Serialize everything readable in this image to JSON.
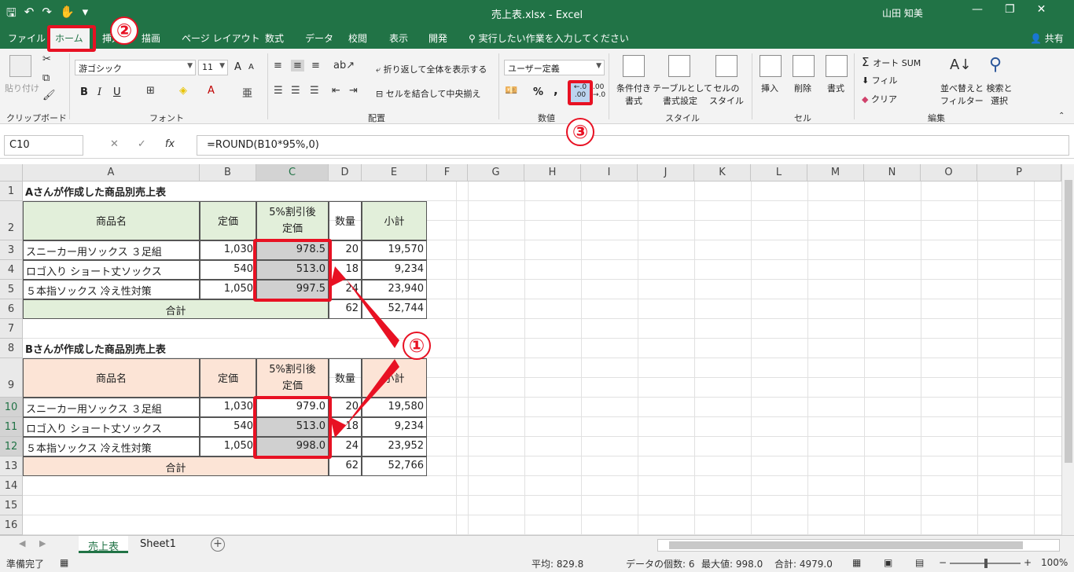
{
  "window": {
    "title": "売上表.xlsx - Excel",
    "user": "山田 知美",
    "minimize": "—",
    "restore": "❐",
    "close": "✕"
  },
  "qat": {
    "save": "🖫",
    "undo": "↶",
    "redo": "↷",
    "touch": "✋",
    "more": "▾"
  },
  "tabs": [
    "ファイル",
    "ホーム",
    "挿入",
    "描画",
    "ページ レイアウト",
    "数式",
    "データ",
    "校閲",
    "表示",
    "開発"
  ],
  "tellme": "実行したい作業を入力してください",
  "share": "共有",
  "ribbon": {
    "clipboard": {
      "label": "クリップボード",
      "paste": "貼り付け"
    },
    "font": {
      "label": "フォント",
      "name": "游ゴシック",
      "size": "11",
      "grow": "A",
      "shrink": "A",
      "bold": "B",
      "italic": "I",
      "underline": "U"
    },
    "alignment": {
      "label": "配置",
      "wrap": "折り返して全体を表示する",
      "merge": "セルを結合して中央揃え"
    },
    "number": {
      "label": "数値",
      "format": "ユーザー定義",
      "percent": "%",
      "comma": ",",
      "inc_decimal": "←.0 .00",
      "dec_decimal": ".00 →.0"
    },
    "styles": {
      "label": "スタイル",
      "conditional": [
        "条件付き",
        "書式"
      ],
      "table": [
        "テーブルとして",
        "書式設定"
      ],
      "cell": [
        "セルの",
        "スタイル"
      ]
    },
    "cells": {
      "label": "セル",
      "insert": "挿入",
      "delete": "削除",
      "format": "書式"
    },
    "editing": {
      "label": "編集",
      "autosum": "オート SUM",
      "fill": "フィル",
      "clear": "クリア",
      "sort": [
        "並べ替えと",
        "フィルター"
      ],
      "find": [
        "検索と",
        "選択"
      ]
    }
  },
  "formula": {
    "namebox": "C10",
    "cancel": "✕",
    "enter": "✓",
    "fx": "fx",
    "value": "=ROUND(B10*95%,0)"
  },
  "columns": [
    "A",
    "B",
    "C",
    "D",
    "E",
    "F",
    "G",
    "H",
    "I",
    "J",
    "K",
    "L",
    "M",
    "N",
    "O",
    "P"
  ],
  "rows": [
    "1",
    "2",
    "3",
    "4",
    "5",
    "6",
    "7",
    "8",
    "9",
    "10",
    "11",
    "12",
    "13",
    "14",
    "15",
    "16"
  ],
  "tableA": {
    "title": "Aさんが作成した商品別売上表",
    "headers": {
      "name": "商品名",
      "price": "定価",
      "disc1": "5%割引後",
      "disc2": "定価",
      "qty": "数量",
      "subtotal": "小計"
    },
    "rows": [
      {
        "name": "スニーカー用ソックス ３足組",
        "price": "1,030",
        "disc": "978.5",
        "qty": "20",
        "subtotal": "19,570"
      },
      {
        "name": "ロゴ入り ショート丈ソックス",
        "price": "540",
        "disc": "513.0",
        "qty": "18",
        "subtotal": "9,234"
      },
      {
        "name": "５本指ソックス 冷え性対策",
        "price": "1,050",
        "disc": "997.5",
        "qty": "24",
        "subtotal": "23,940"
      }
    ],
    "total": {
      "label": "合計",
      "qty": "62",
      "subtotal": "52,744"
    }
  },
  "tableB": {
    "title": "Bさんが作成した商品別売上表",
    "headers": {
      "name": "商品名",
      "price": "定価",
      "disc1": "5%割引後",
      "disc2": "定価",
      "qty": "数量",
      "subtotal": "小計"
    },
    "rows": [
      {
        "name": "スニーカー用ソックス ３足組",
        "price": "1,030",
        "disc": "979.0",
        "qty": "20",
        "subtotal": "19,580"
      },
      {
        "name": "ロゴ入り ショート丈ソックス",
        "price": "540",
        "disc": "513.0",
        "qty": "18",
        "subtotal": "9,234"
      },
      {
        "name": "５本指ソックス 冷え性対策",
        "price": "1,050",
        "disc": "998.0",
        "qty": "24",
        "subtotal": "23,952"
      }
    ],
    "total": {
      "label": "合計",
      "qty": "62",
      "subtotal": "52,766"
    }
  },
  "annotations": {
    "one": "①",
    "two": "②",
    "three": "③"
  },
  "sheets": [
    "売上表",
    "Sheet1"
  ],
  "add_sheet": "+",
  "status": {
    "ready": "準備完了",
    "average": "平均: 829.8",
    "count": "データの個数: 6",
    "max": "最大値: 998.0",
    "sum": "合計: 4979.0",
    "zoom": "100%",
    "zoom_minus": "−",
    "zoom_plus": "+"
  },
  "colors": {
    "accent": "#217346",
    "highlight": "#e81123",
    "green_fill": "#e2efda",
    "pink_fill": "#fce4d6",
    "selected_fill": "#d0d0d0"
  }
}
